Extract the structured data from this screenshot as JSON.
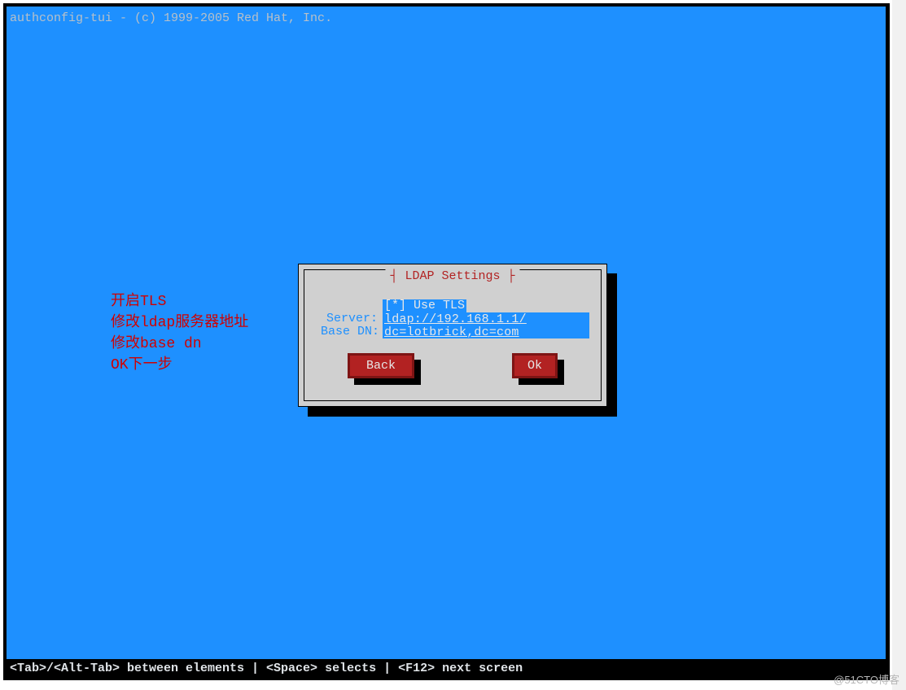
{
  "header": {
    "title": "authconfig-tui - (c) 1999-2005 Red Hat, Inc."
  },
  "dialog": {
    "title": "LDAP Settings",
    "use_tls_label": "[*] Use TLS",
    "server_label": "Server:",
    "server_value": "ldap://192.168.1.1/",
    "base_dn_label": "Base DN:",
    "base_dn_value": "dc=lotbrick,dc=com",
    "back_label": "Back",
    "ok_label": "Ok"
  },
  "footer": {
    "hint": "<Tab>/<Alt-Tab> between elements   |   <Space> selects   |  <F12> next screen"
  },
  "annotations": {
    "line1": "开启TLS",
    "line2": "修改ldap服务器地址",
    "line3": "修改base dn",
    "line4": "OK下一步"
  },
  "watermark": "@51CTO博客"
}
